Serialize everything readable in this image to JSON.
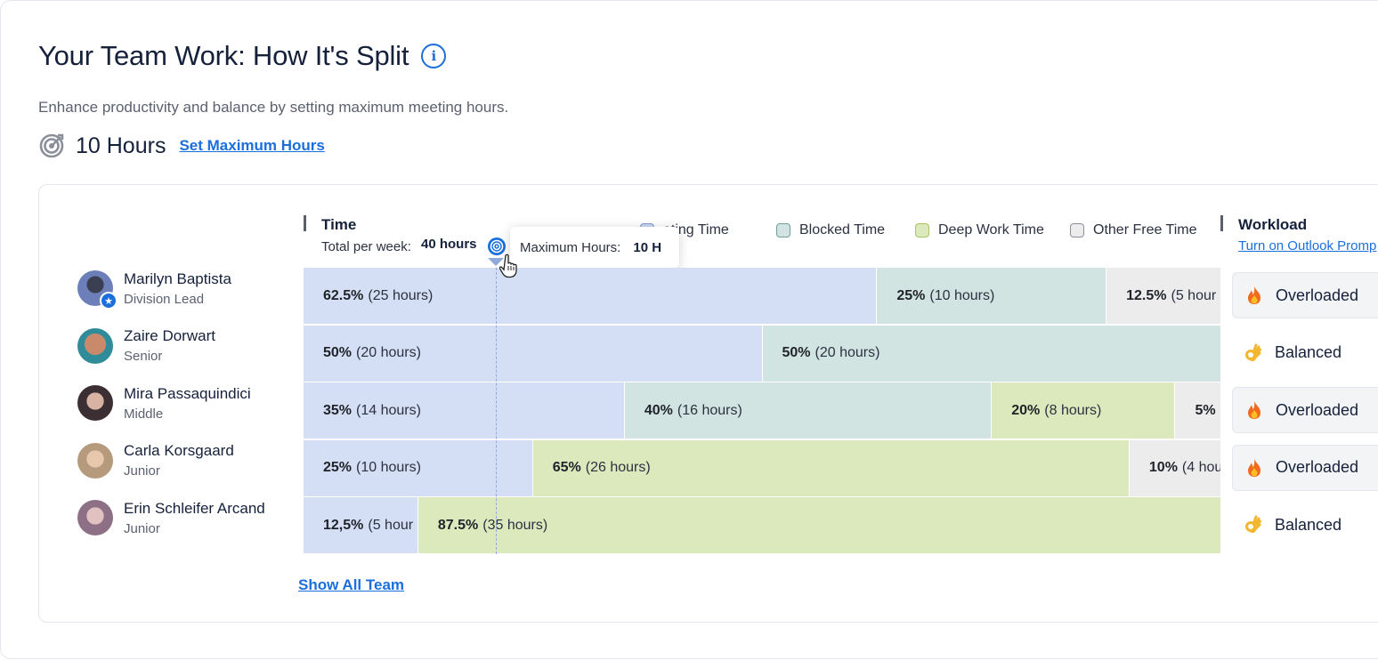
{
  "header": {
    "title": "Your Team Work: How It's Split",
    "subtitle": "Enhance productivity and balance by setting maximum meeting hours.",
    "hours_value": "10 Hours",
    "set_max_link": "Set Maximum Hours"
  },
  "time_header": {
    "label": "Time",
    "total_label": "Total per week:",
    "total_value": "40 hours"
  },
  "tooltip": {
    "label": "Maximum Hours:",
    "value": "10 H"
  },
  "legend": [
    {
      "label": "eting Time",
      "color": "#c9d7f3"
    },
    {
      "label": "Blocked Time",
      "color": "#d2e4e2"
    },
    {
      "label": "Deep Work Time",
      "color": "#dce9bd"
    },
    {
      "label": "Other Free Time",
      "color": "#ececec"
    }
  ],
  "workload_header": {
    "label": "Workload",
    "link": "Turn on Outlook Promp"
  },
  "team": [
    {
      "name": "Marilyn Baptista",
      "role": "Division Lead",
      "status": "Overloaded",
      "segments": [
        {
          "type": "meeting",
          "pct": "62.5%",
          "hours": "(25 hours)",
          "value": 62.5
        },
        {
          "type": "blocked",
          "pct": "25%",
          "hours": "(10 hours)",
          "value": 25
        },
        {
          "type": "free",
          "pct": "12.5%",
          "hours": "(5 hour",
          "value": 12.5
        }
      ]
    },
    {
      "name": "Zaire Dorwart",
      "role": "Senior",
      "status": "Balanced",
      "segments": [
        {
          "type": "meeting",
          "pct": "50%",
          "hours": "(20 hours)",
          "value": 50
        },
        {
          "type": "blocked",
          "pct": "50%",
          "hours": "(20 hours)",
          "value": 50
        }
      ]
    },
    {
      "name": "Mira Passaquindici",
      "role": "Middle",
      "status": "Overloaded",
      "segments": [
        {
          "type": "meeting",
          "pct": "35%",
          "hours": "(14 hours)",
          "value": 35
        },
        {
          "type": "blocked",
          "pct": "40%",
          "hours": "(16 hours)",
          "value": 40
        },
        {
          "type": "deep",
          "pct": "20%",
          "hours": "(8 hours)",
          "value": 20
        },
        {
          "type": "free",
          "pct": "5%",
          "hours": "(",
          "value": 5
        }
      ]
    },
    {
      "name": "Carla Korsgaard",
      "role": "Junior",
      "status": "Overloaded",
      "segments": [
        {
          "type": "meeting",
          "pct": "25%",
          "hours": "(10 hours)",
          "value": 25
        },
        {
          "type": "deep",
          "pct": "65%",
          "hours": "(26 hours)",
          "value": 65
        },
        {
          "type": "free",
          "pct": "10%",
          "hours": "(4 hou",
          "value": 10
        }
      ]
    },
    {
      "name": "Erin Schleifer  Arcand",
      "role": "Junior",
      "status": "Balanced",
      "segments": [
        {
          "type": "meeting",
          "pct": "12,5%",
          "hours": "(5 hour",
          "value": 12.5
        },
        {
          "type": "deep",
          "pct": "87.5%",
          "hours": "(35 hours)",
          "value": 87.5
        }
      ]
    }
  ],
  "max_hours_fraction": 0.25,
  "show_all": "Show All Team",
  "icons": {
    "info": "info-icon",
    "target": "target-icon",
    "overloaded": "fire-icon",
    "balanced": "ok-hand-icon"
  }
}
